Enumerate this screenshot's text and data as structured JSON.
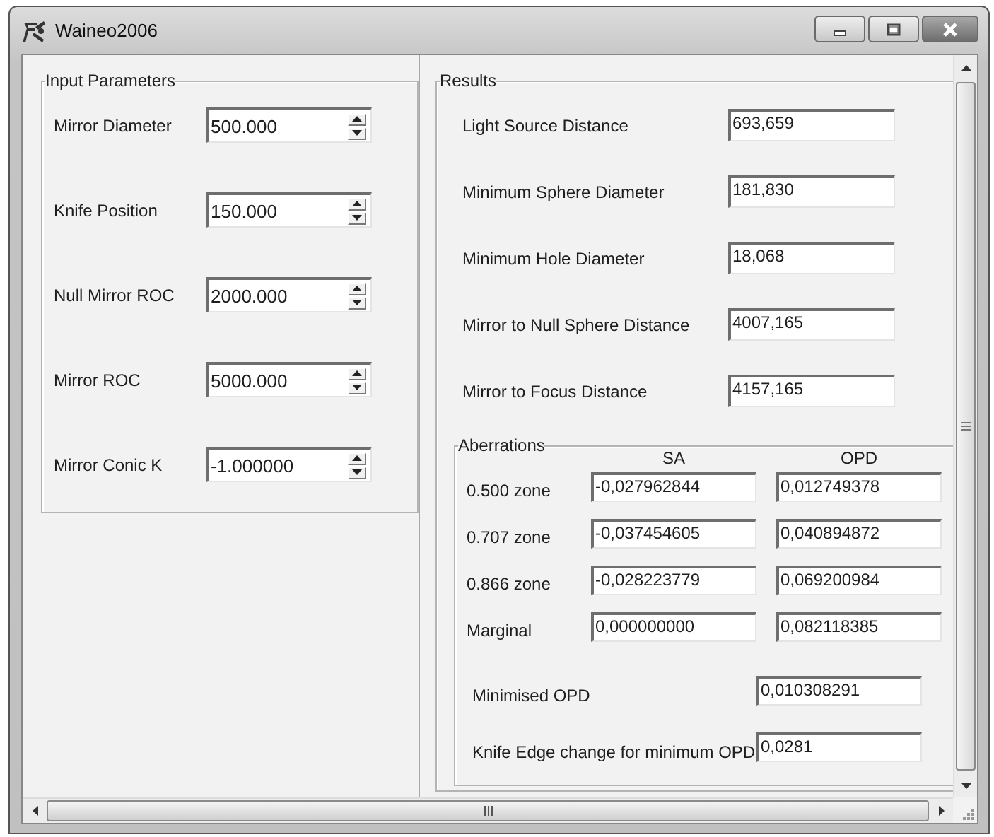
{
  "window": {
    "title": "Waineo2006"
  },
  "input_parameters": {
    "title": "Input Parameters",
    "fields": [
      {
        "label": "Mirror Diameter",
        "value": "500.000"
      },
      {
        "label": "Knife Position",
        "value": "150.000"
      },
      {
        "label": "Null Mirror ROC",
        "value": "2000.000"
      },
      {
        "label": "Mirror ROC",
        "value": "5000.000"
      },
      {
        "label": "Mirror Conic K",
        "value": "-1.000000"
      }
    ]
  },
  "results": {
    "title": "Results",
    "fields": [
      {
        "label": "Light Source Distance",
        "value": "693,659"
      },
      {
        "label": "Minimum Sphere Diameter",
        "value": "181,830"
      },
      {
        "label": "Minimum Hole Diameter",
        "value": "18,068"
      },
      {
        "label": "Mirror to Null Sphere Distance",
        "value": "4007,165"
      },
      {
        "label": "Mirror to Focus Distance",
        "value": "4157,165"
      }
    ],
    "aberrations": {
      "title": "Aberrations",
      "columns": [
        "SA",
        "OPD"
      ],
      "rows": [
        {
          "label": "0.500 zone",
          "sa": "-0,027962844",
          "opd": "0,012749378"
        },
        {
          "label": "0.707 zone",
          "sa": "-0,037454605",
          "opd": "0,040894872"
        },
        {
          "label": "0.866 zone",
          "sa": "-0,028223779",
          "opd": "0,069200984"
        },
        {
          "label": "Marginal",
          "sa": "0,000000000",
          "opd": "0,082118385"
        }
      ],
      "summary": [
        {
          "label": "Minimised OPD",
          "value": "0,010308291"
        },
        {
          "label": "Knife Edge change for minimum OPD",
          "value": "0,0281"
        }
      ]
    }
  }
}
